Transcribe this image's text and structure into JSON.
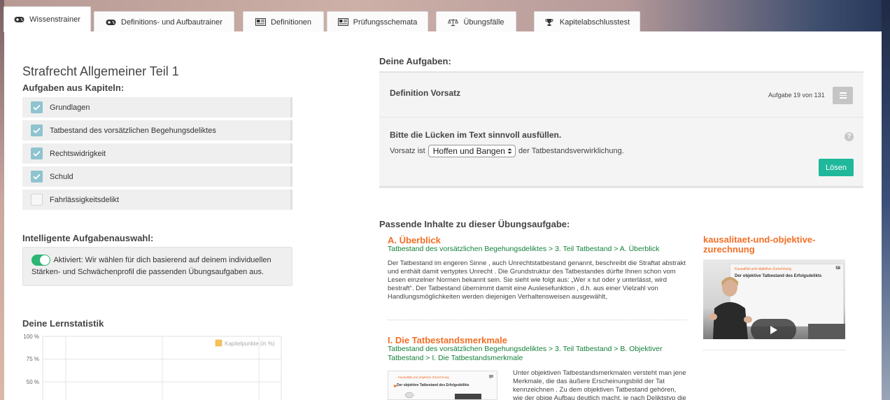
{
  "tabs": [
    {
      "label": "Wissenstrainer",
      "icon": "gamepad-icon",
      "active": true
    },
    {
      "label": "Definitions- und Aufbautrainer",
      "icon": "gamepad-icon",
      "active": false
    },
    {
      "label": "Definitionen",
      "icon": "newspaper-icon",
      "active": false
    },
    {
      "label": "Prüfungsschemata",
      "icon": "newspaper-icon",
      "active": false
    },
    {
      "label": "Übungsfälle",
      "icon": "scales-icon",
      "active": false
    },
    {
      "label": "Kapitelabschlusstest",
      "icon": "trophy-icon",
      "active": false
    }
  ],
  "left": {
    "course_title": "Strafrecht Allgemeiner Teil 1",
    "chapters_label": "Aufgaben aus Kapiteln:",
    "chapters": [
      {
        "label": "Grundlagen",
        "checked": true
      },
      {
        "label": "Tatbestand des vorsätzlichen Begehungsdeliktes",
        "checked": true
      },
      {
        "label": "Rechtswidrigkeit",
        "checked": true
      },
      {
        "label": "Schuld",
        "checked": true
      },
      {
        "label": "Fahrlässigkeitsdelikt",
        "checked": false
      }
    ],
    "smart_label": "Intelligente Aufgabenauswahl:",
    "smart_text": "Aktiviert: Wir wählen für dich basierend auf deinem individuellen Stärken- und Schwächenprofil die passenden Übungsaufgaben aus.",
    "smart_enabled": true,
    "stats_label": "Deine Lernstatistik",
    "chart_data": {
      "type": "bar",
      "categories": [],
      "series": [
        {
          "name": "Kapitelpunkte (in %)",
          "values": []
        }
      ],
      "yticks": [
        "100 %",
        "75 %",
        "50 %"
      ],
      "ylim": [
        0,
        100
      ],
      "legend": "top-right",
      "grid": true,
      "series_color": "#f5c15c"
    }
  },
  "right": {
    "tasks_label": "Deine Aufgaben:",
    "task_title": "Definition Vorsatz",
    "task_counter": "Aufgabe 19 von 131",
    "instruction": "Bitte die Lücken im Text sinnvoll ausfüllen.",
    "sentence_pre": "Vorsatz ist",
    "select_value": "Hoffen und Bangen",
    "sentence_post": "der Tatbestandsverwirklichung.",
    "solve_label": "Lösen",
    "help_glyph": "?",
    "related_label": "Passende Inhalte zu dieser Übungsaufgabe:",
    "contents": [
      {
        "title": "A. Überblick",
        "path": "Tatbestand des vorsätzlichen Begehungsdeliktes > 3. Teil Tatbestand > A. Überblick",
        "text": "Der Tatbestand im engeren Sinne , auch Unrechtstatbestand genannt, beschreibt die Straftat abstrakt und enthält damit vertyptes Unrecht . Die Grundstruktur des Tatbestandes dürfte Ihnen schon vom Lesen einzelner Normen bekannt sein. Sie sieht wie folgt aus: „Wer x tut oder y unterlässt, wird bestraft“. Der Tatbestand übernimmt damit eine Auslesefunktion , d.h. aus einer Vielzahl von Handlungsmöglichkeiten werden diejenigen Verhaltensweisen ausgewählt,"
      },
      {
        "title": "I. Die Tatbestandsmerkmale",
        "path": "Tatbestand des vorsätzlichen Begehungsdeliktes > 3. Teil Tatbestand > B. Objektiver Tatbestand > I. Die Tatbestandsmerkmale",
        "text": "Unter objektiven Tatbestandsmerkmalen versteht man jene Merkmale, die das äußere Erscheinungsbild der Tat kennzeichnen . Zu dem objektiven Tatbestand gehören, wie der obige Aufbau deutlich macht, je nach Deliktstyp die"
      }
    ],
    "video": {
      "title": "kausalitaet-und-objektive-zurechnung",
      "slide_header": "Kausalität und objektive Zurechnung",
      "slide_title": "Der objektive Tatbestand des Erfolgsdelikts",
      "slide_number": "58"
    },
    "thumb": {
      "header": "Kausalität und objektive Zurechnung",
      "title": "Der objektive Tatbestand des Erfolgsdelikts"
    }
  },
  "colors": {
    "accent_orange": "#f36f26",
    "path_green": "#14803a",
    "solve_teal": "#1fb89b",
    "toggle_green": "#2bb673",
    "checkbox_blue": "#8fc3cf"
  }
}
